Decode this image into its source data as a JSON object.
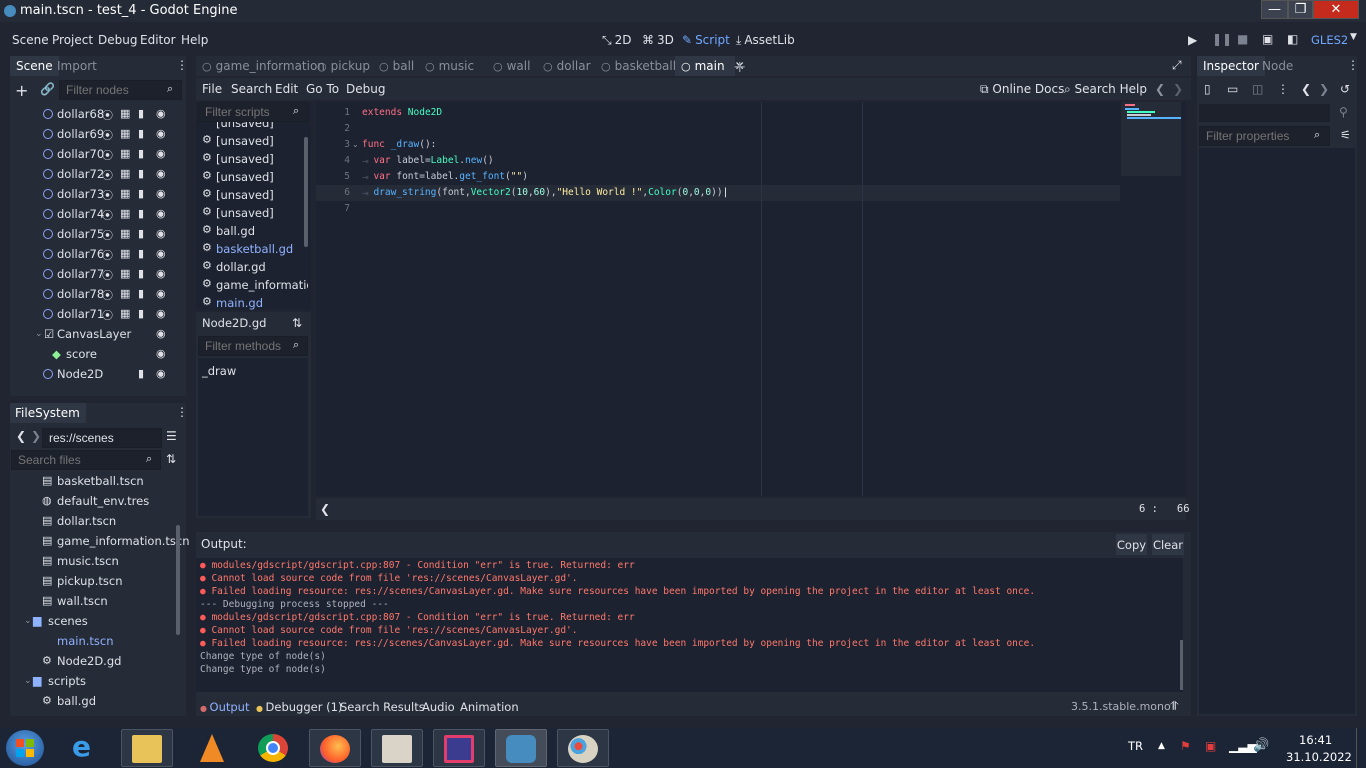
{
  "window": {
    "title": "main.tscn - test_4 - Godot Engine",
    "minimize": "—",
    "maximize": "❐",
    "close": "✕"
  },
  "menu": {
    "items": [
      "Scene",
      "Project",
      "Debug",
      "Editor",
      "Help"
    ],
    "modes": [
      "2D",
      "3D",
      "Script",
      "AssetLib"
    ],
    "active_mode": "Script",
    "renderer": "GLES2"
  },
  "scene_dock": {
    "tabs": [
      "Scene",
      "Import"
    ],
    "filter_placeholder": "Filter nodes",
    "nodes": [
      {
        "label": "dollar68",
        "indent": 1
      },
      {
        "label": "dollar69",
        "indent": 1
      },
      {
        "label": "dollar70",
        "indent": 1
      },
      {
        "label": "dollar72",
        "indent": 1
      },
      {
        "label": "dollar73",
        "indent": 1
      },
      {
        "label": "dollar74",
        "indent": 1
      },
      {
        "label": "dollar75",
        "indent": 1
      },
      {
        "label": "dollar76",
        "indent": 1
      },
      {
        "label": "dollar77",
        "indent": 1
      },
      {
        "label": "dollar78",
        "indent": 1
      },
      {
        "label": "dollar71",
        "indent": 1
      }
    ],
    "canvas_layer": "CanvasLayer",
    "score": "score",
    "node2d": "Node2D"
  },
  "filesystem": {
    "title": "FileSystem",
    "path": "res://scenes",
    "search_placeholder": "Search files",
    "files": [
      {
        "label": "basketball.tscn",
        "type": "scene"
      },
      {
        "label": "default_env.tres",
        "type": "env"
      },
      {
        "label": "dollar.tscn",
        "type": "scene"
      },
      {
        "label": "game_information.tscn",
        "type": "scene"
      },
      {
        "label": "music.tscn",
        "type": "scene"
      },
      {
        "label": "pickup.tscn",
        "type": "scene"
      },
      {
        "label": "wall.tscn",
        "type": "scene"
      }
    ],
    "folder_scenes": "scenes",
    "main_tscn": "main.tscn",
    "node2d_gd": "Node2D.gd",
    "folder_scripts": "scripts",
    "ball_gd": "ball.gd"
  },
  "editor_tabs": [
    "game_information",
    "pickup",
    "ball",
    "music",
    "wall",
    "dollar",
    "basketball",
    "main"
  ],
  "active_editor_tab": "main",
  "script_menu": [
    "File",
    "Search",
    "Edit",
    "Go To",
    "Debug"
  ],
  "script_menu_right": {
    "online_docs": "Online Docs",
    "search_help": "Search Help"
  },
  "scripts_panel": {
    "filter_placeholder": "Filter scripts",
    "partial_top": "[unsaved]",
    "items": [
      {
        "label": "[unsaved]",
        "blue": false,
        "gear": true
      },
      {
        "label": "[unsaved]",
        "blue": false,
        "gear": true
      },
      {
        "label": "[unsaved]",
        "blue": false,
        "gear": true
      },
      {
        "label": "[unsaved]",
        "blue": false,
        "gear": true
      },
      {
        "label": "[unsaved]",
        "blue": false,
        "gear": true
      },
      {
        "label": "ball.gd",
        "blue": false,
        "gear": true
      },
      {
        "label": "basketball.gd",
        "blue": true,
        "gear": true
      },
      {
        "label": "dollar.gd",
        "blue": false,
        "gear": true
      },
      {
        "label": "game_information.gd",
        "blue": false,
        "gear": true
      },
      {
        "label": "main.gd",
        "blue": true,
        "gear": true
      }
    ],
    "current_script": "Node2D.gd",
    "methods_placeholder": "Filter methods",
    "methods": [
      "_draw"
    ]
  },
  "code": {
    "line_numbers": [
      "1",
      "2",
      "3",
      "4",
      "5",
      "6",
      "7"
    ],
    "cursor_position": "6 :   66"
  },
  "output": {
    "title": "Output:",
    "copy": "Copy",
    "clear": "Clear",
    "lines": [
      {
        "text": "modules/gdscript/gdscript.cpp:807 - Condition \"err\" is true. Returned: err",
        "kind": "err"
      },
      {
        "text": "Cannot load source code from file 'res://scenes/CanvasLayer.gd'.",
        "kind": "err"
      },
      {
        "text": "Failed loading resource: res://scenes/CanvasLayer.gd. Make sure resources have been imported by opening the project in the editor at least once.",
        "kind": "err"
      },
      {
        "text": "--- Debugging process stopped ---",
        "kind": "dim"
      },
      {
        "text": "modules/gdscript/gdscript.cpp:807 - Condition \"err\" is true. Returned: err",
        "kind": "err"
      },
      {
        "text": "Cannot load source code from file 'res://scenes/CanvasLayer.gd'.",
        "kind": "err"
      },
      {
        "text": "Failed loading resource: res://scenes/CanvasLayer.gd. Make sure resources have been imported by opening the project in the editor at least once.",
        "kind": "err"
      },
      {
        "text": "Change type of node(s)",
        "kind": "dim"
      },
      {
        "text": "Change type of node(s)",
        "kind": "dim"
      }
    ]
  },
  "bottom_tabs": [
    "Output",
    "Debugger (1)",
    "Search Results",
    "Audio",
    "Animation"
  ],
  "version": "3.5.1.stable.mono",
  "inspector": {
    "tabs": [
      "Inspector",
      "Node"
    ],
    "filter_placeholder": "Filter properties"
  },
  "taskbar": {
    "lang": "TR",
    "time": "16:41",
    "date": "31.10.2022"
  }
}
